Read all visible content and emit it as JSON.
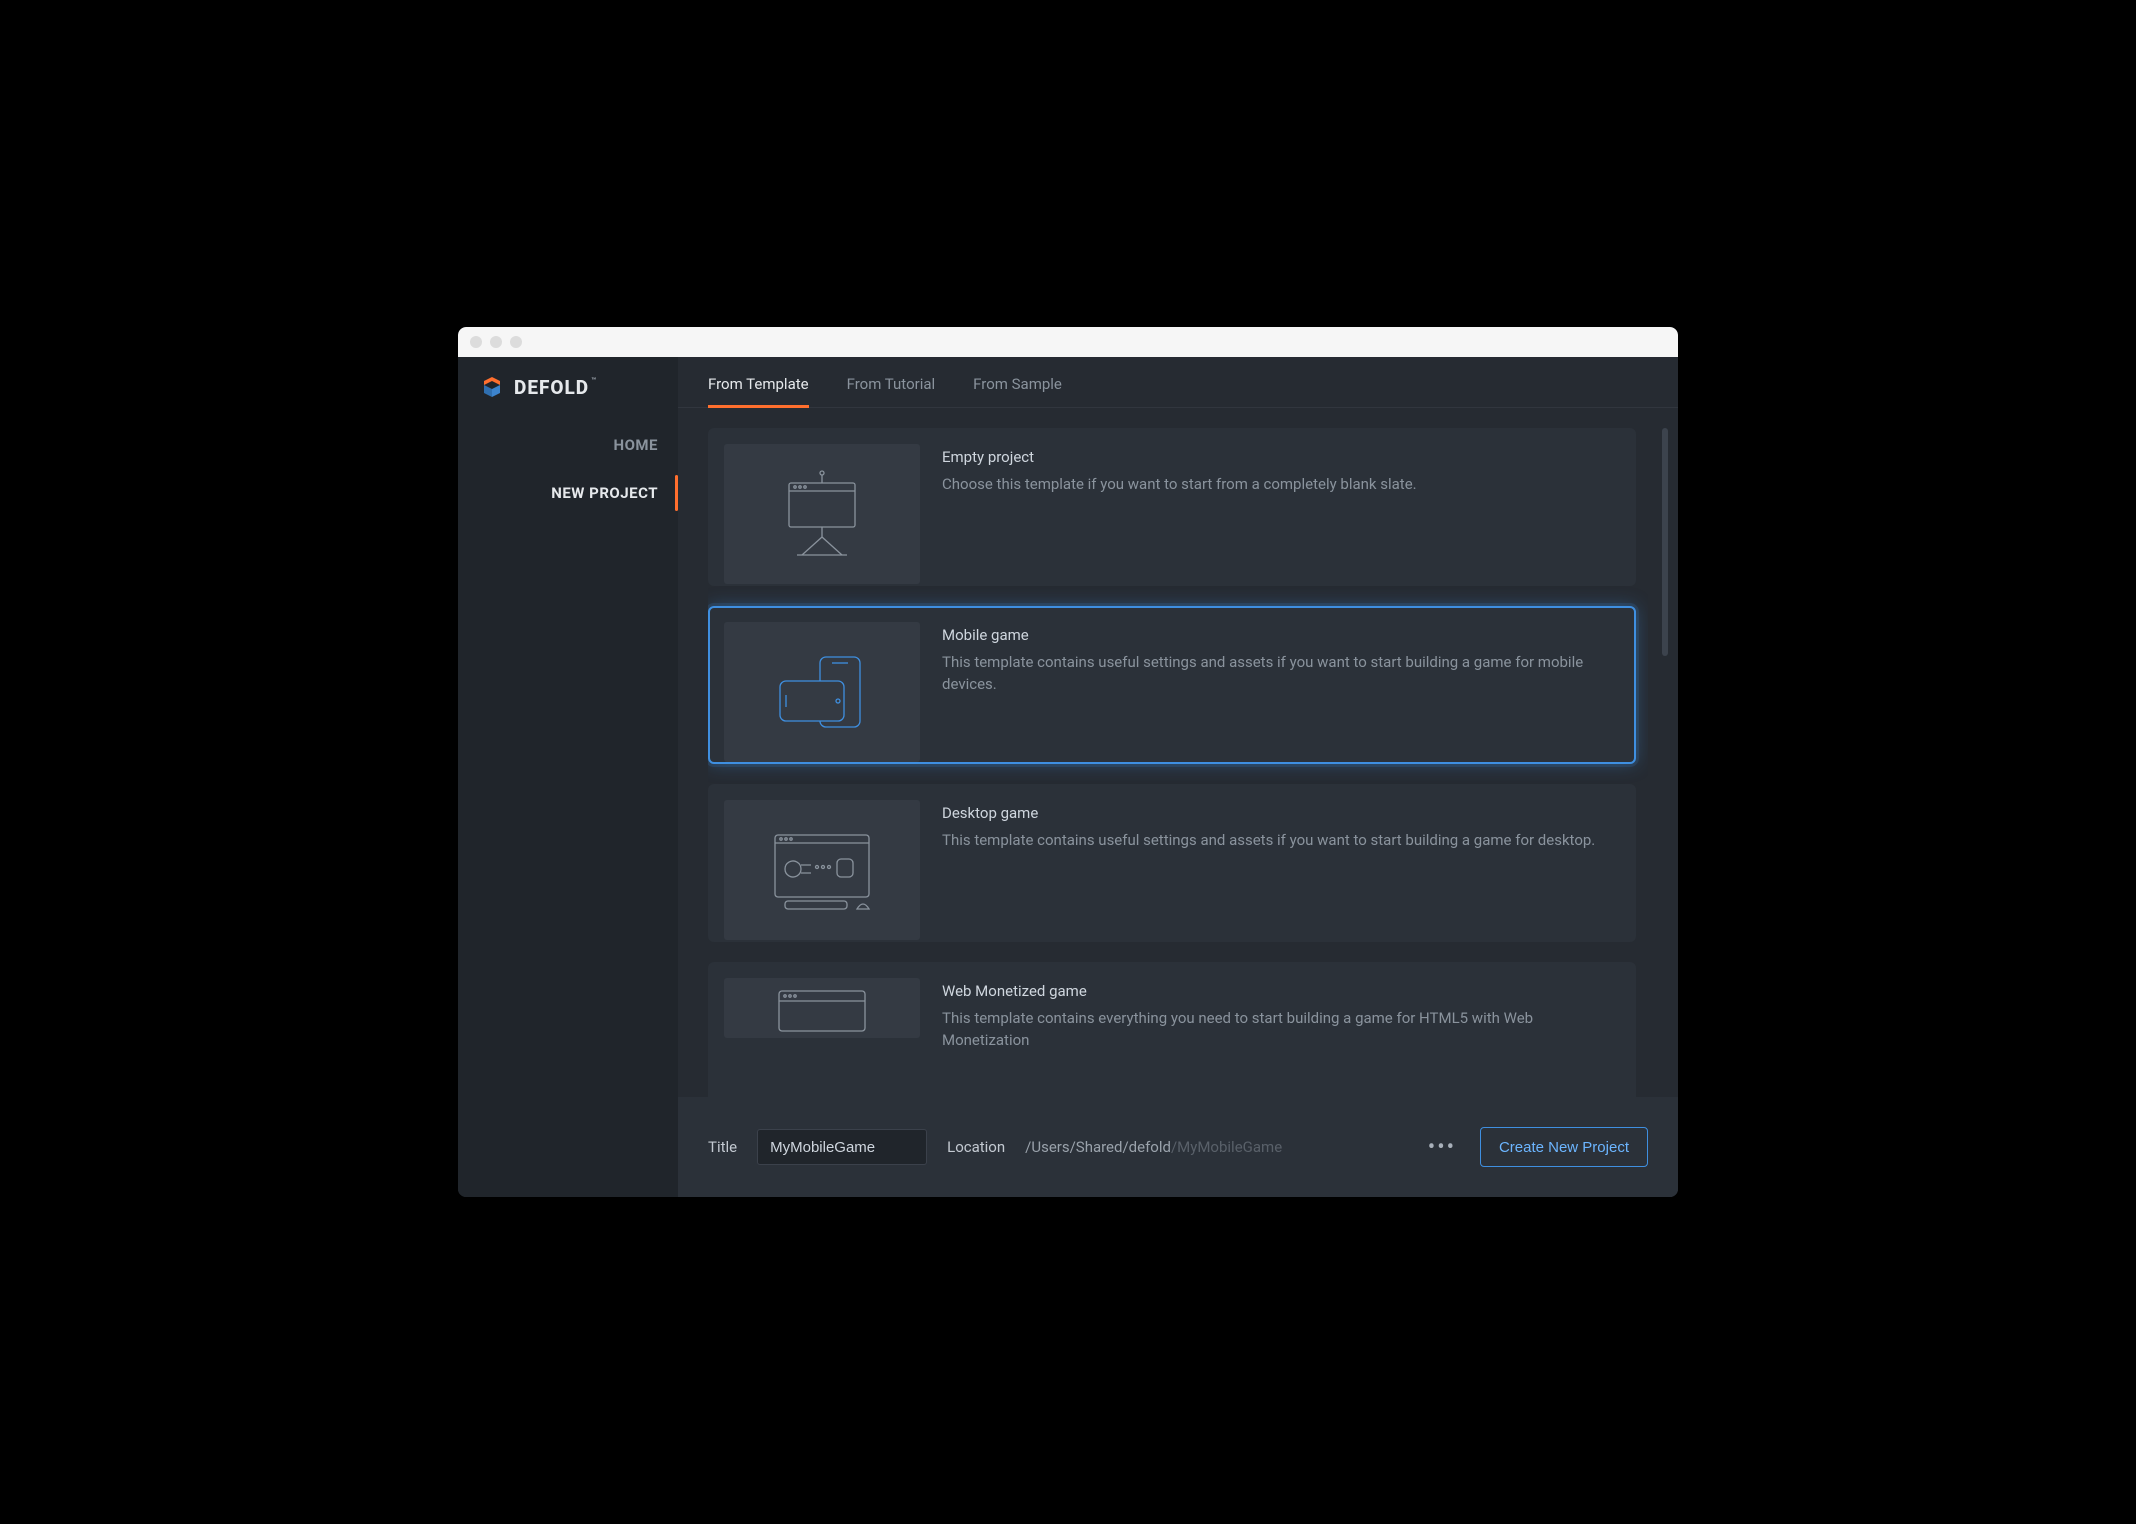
{
  "brand": {
    "name": "DEFOLD"
  },
  "sidebar": {
    "items": [
      {
        "label": "HOME",
        "selected": false
      },
      {
        "label": "NEW PROJECT",
        "selected": true
      }
    ]
  },
  "tabs": [
    {
      "label": "From Template",
      "selected": true
    },
    {
      "label": "From Tutorial",
      "selected": false
    },
    {
      "label": "From Sample",
      "selected": false
    }
  ],
  "templates": [
    {
      "title": "Empty project",
      "desc": "Choose this template if you want to start from a completely blank slate.",
      "selected": false,
      "icon": "easel"
    },
    {
      "title": "Mobile game",
      "desc": "This template contains useful settings and assets if you want to start building a game for mobile devices.",
      "selected": true,
      "icon": "mobile"
    },
    {
      "title": "Desktop game",
      "desc": "This template contains useful settings and assets if you want to start building a game for desktop.",
      "selected": false,
      "icon": "desktop"
    },
    {
      "title": "Web Monetized game",
      "desc": "This template contains everything you need to start building a game for HTML5 with Web Monetization",
      "selected": false,
      "icon": "web"
    }
  ],
  "footer": {
    "title_label": "Title",
    "title_value": "MyMobileGame",
    "location_label": "Location",
    "location_path": "/Users/Shared/defold",
    "location_suffix": "/MyMobileGame",
    "ellipsis": "•••",
    "create_label": "Create New Project"
  },
  "colors": {
    "accent": "#ff6f2e",
    "selection": "#3f8fe0"
  }
}
